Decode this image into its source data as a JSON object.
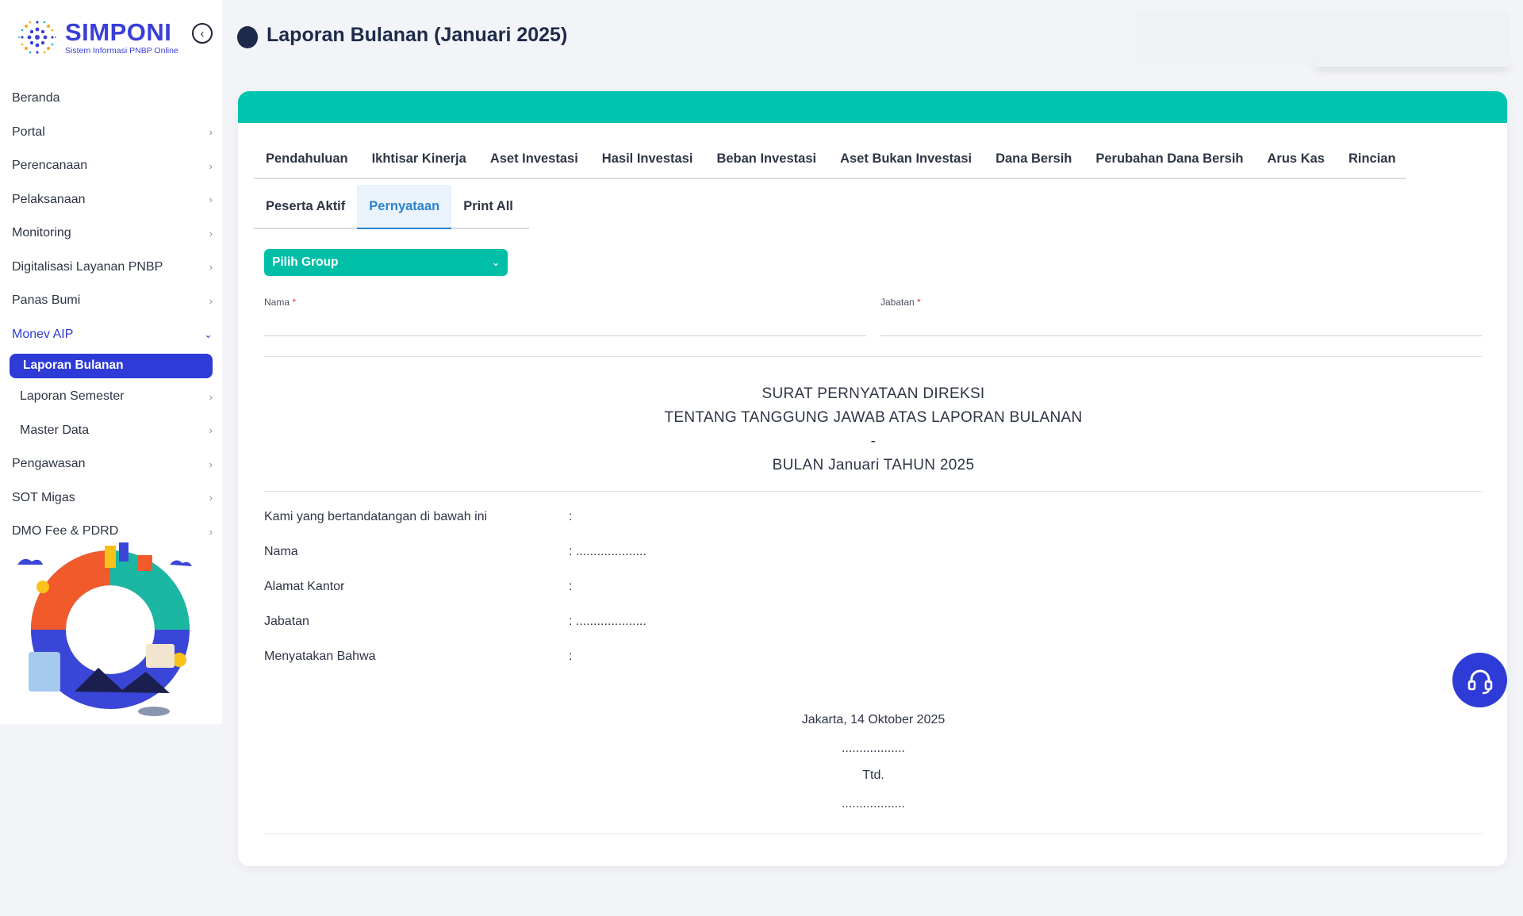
{
  "brand": {
    "name": "SIMPONI",
    "tagline": "Sistem Informasi PNBP Online"
  },
  "sidebar": {
    "items": [
      {
        "label": "Beranda"
      },
      {
        "label": "Portal"
      },
      {
        "label": "Perencanaan"
      },
      {
        "label": "Pelaksanaan"
      },
      {
        "label": "Monitoring"
      },
      {
        "label": "Digitalisasi Layanan PNBP"
      },
      {
        "label": "Panas Bumi"
      },
      {
        "label": "Monev AIP"
      },
      {
        "label": "Laporan Bulanan"
      },
      {
        "label": "Laporan Semester"
      },
      {
        "label": "Master Data"
      },
      {
        "label": "Pengawasan"
      },
      {
        "label": "SOT Migas"
      },
      {
        "label": "DMO Fee & PDRD"
      }
    ]
  },
  "header": {
    "title": "Laporan Bulanan (Januari 2025)"
  },
  "tabs": {
    "row1": [
      "Pendahuluan",
      "Ikhtisar Kinerja",
      "Aset Investasi",
      "Hasil Investasi",
      "Beban Investasi",
      "Aset Bukan Investasi",
      "Dana Bersih",
      "Perubahan Dana Bersih",
      "Arus Kas",
      "Rincian"
    ],
    "row2": [
      "Peserta Aktif",
      "Pernyataan",
      "Print All"
    ],
    "active": "Pernyataan"
  },
  "form": {
    "group_select": "Pilih Group",
    "nama_label": "Nama",
    "jabatan_label": "Jabatan",
    "required_mark": "*"
  },
  "letter": {
    "title_line1": "SURAT PERNYATAAN DIREKSI",
    "title_line2": "TENTANG TANGGUNG JAWAB ATAS LAPORAN BULANAN",
    "title_line3": "-",
    "title_line4": "BULAN Januari TAHUN 2025",
    "rows": [
      {
        "label": "Kami yang bertandatangan di bawah ini",
        "value": ":"
      },
      {
        "label": "Nama",
        "value": ": ...................."
      },
      {
        "label": "Alamat Kantor",
        "value": ":"
      },
      {
        "label": "Jabatan",
        "value": ": ...................."
      },
      {
        "label": "Menyatakan Bahwa",
        "value": ":"
      }
    ],
    "place_date": "Jakarta, 14 Oktober 2025",
    "dots1": "..................",
    "ttd": "Ttd.",
    "dots2": ".................."
  },
  "colors": {
    "primary": "#2f3bd6",
    "teal": "#00c4ad",
    "tab_active": "#2a83cf"
  }
}
